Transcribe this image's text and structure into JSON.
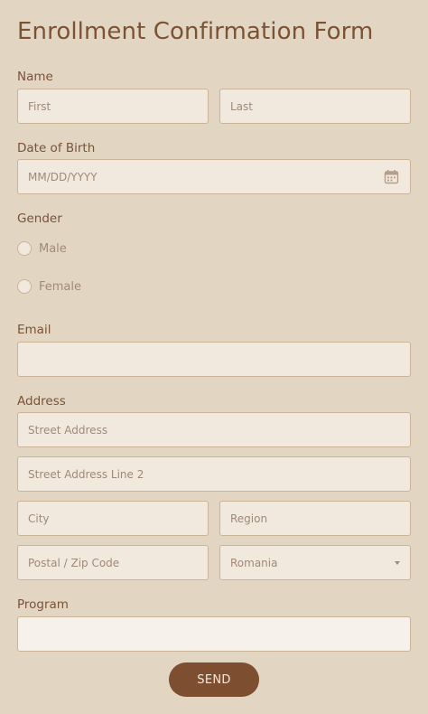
{
  "form": {
    "title": "Enrollment Confirmation Form",
    "name": {
      "label": "Name",
      "first_placeholder": "First",
      "last_placeholder": "Last"
    },
    "dob": {
      "label": "Date of Birth",
      "placeholder": "MM/DD/YYYY",
      "icon": "calendar-icon"
    },
    "gender": {
      "label": "Gender",
      "options": [
        "Male",
        "Female"
      ]
    },
    "email": {
      "label": "Email",
      "value": ""
    },
    "address": {
      "label": "Address",
      "street_placeholder": "Street Address",
      "street2_placeholder": "Street Address Line 2",
      "city_placeholder": "City",
      "region_placeholder": "Region",
      "postal_placeholder": "Postal / Zip Code",
      "country_selected": "Romania"
    },
    "program": {
      "label": "Program",
      "value": ""
    },
    "send_label": "SEND"
  },
  "colors": {
    "background": "#e2d6c3",
    "input_background": "#f1e8de",
    "text": "#7a5236",
    "button": "#7d4e30"
  }
}
